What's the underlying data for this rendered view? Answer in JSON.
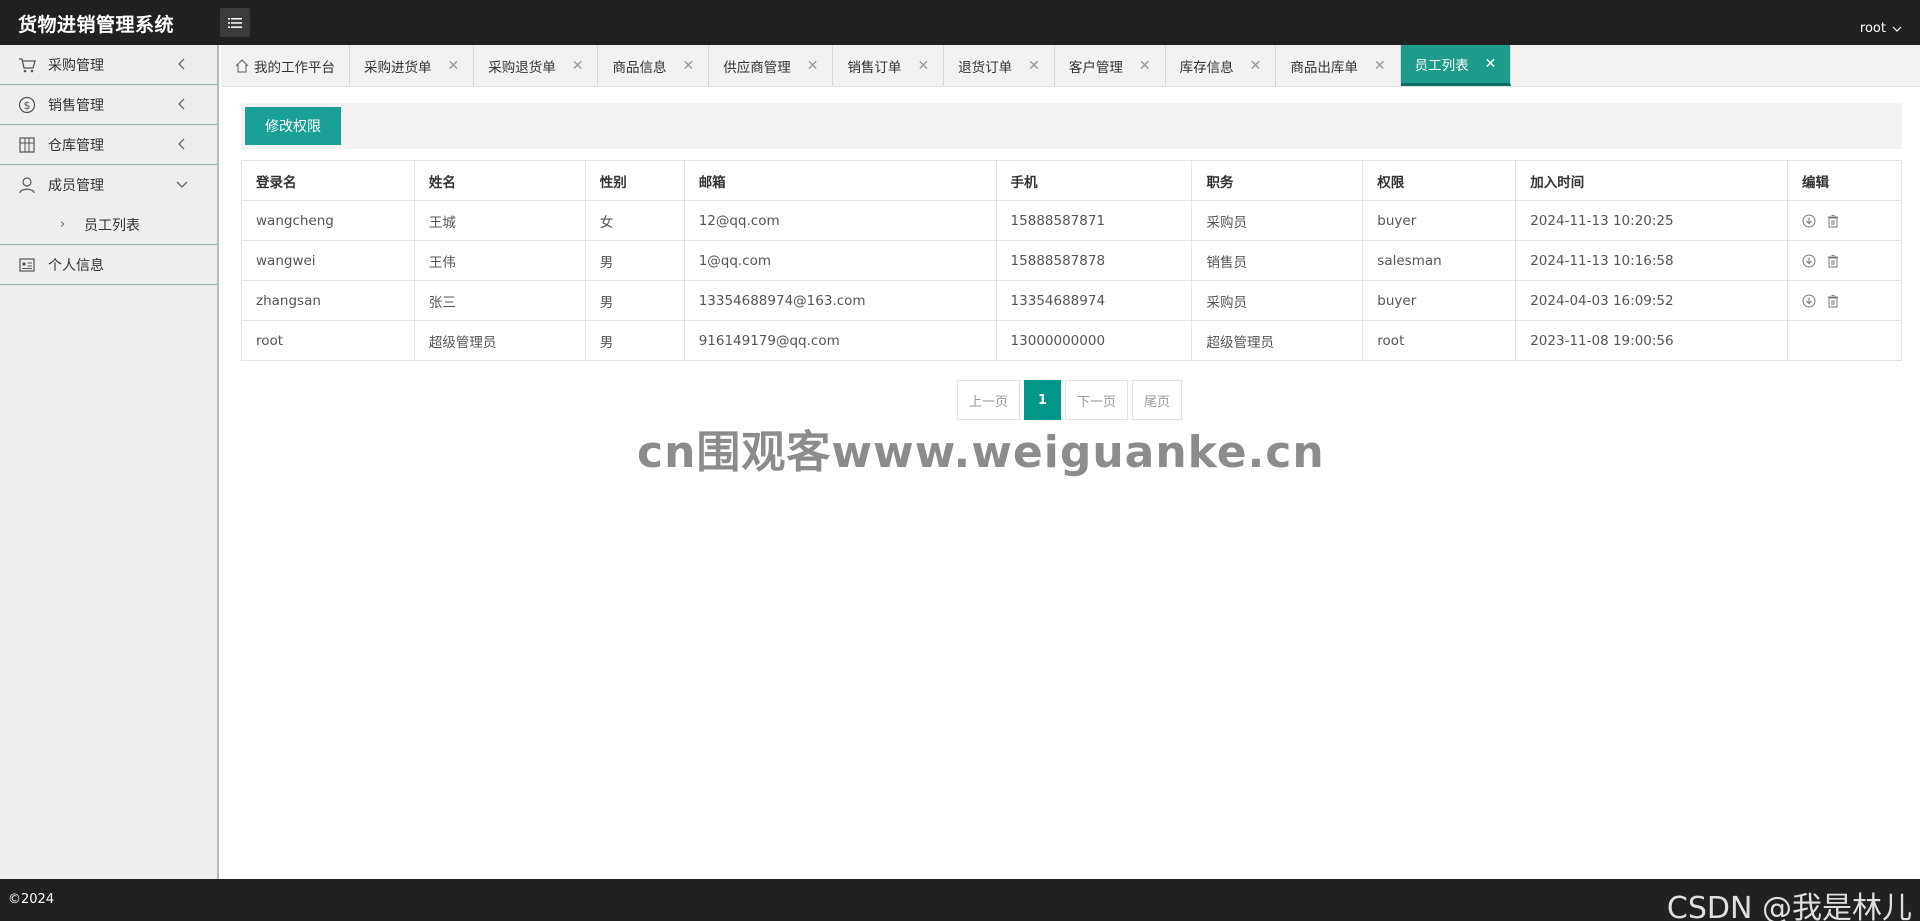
{
  "header": {
    "app_title": "货物进销管理系统",
    "user_name": "root"
  },
  "sidebar": {
    "items": [
      {
        "label": "采购管理",
        "icon": "cart-icon"
      },
      {
        "label": "销售管理",
        "icon": "dollar-icon"
      },
      {
        "label": "仓库管理",
        "icon": "warehouse-icon"
      },
      {
        "label": "成员管理",
        "icon": "user-icon"
      },
      {
        "label": "个人信息",
        "icon": "id-card-icon"
      }
    ],
    "sub_items": [
      {
        "label": "员工列表"
      }
    ]
  },
  "tabs": [
    {
      "label": "我的工作平台"
    },
    {
      "label": "采购进货单"
    },
    {
      "label": "采购退货单"
    },
    {
      "label": "商品信息"
    },
    {
      "label": "供应商管理"
    },
    {
      "label": "销售订单"
    },
    {
      "label": "退货订单"
    },
    {
      "label": "客户管理"
    },
    {
      "label": "库存信息"
    },
    {
      "label": "商品出库单"
    },
    {
      "label": "员工列表"
    }
  ],
  "toolbar": {
    "edit_perm_label": "修改权限"
  },
  "table": {
    "columns": [
      "登录名",
      "姓名",
      "性别",
      "邮箱",
      "手机",
      "职务",
      "权限",
      "加入时间",
      "编辑"
    ],
    "rows": [
      [
        "wangcheng",
        "王城",
        "女",
        "12@qq.com",
        "15888587871",
        "采购员",
        "buyer",
        "2024-11-13 10:20:25"
      ],
      [
        "wangwei",
        "王伟",
        "男",
        "1@qq.com",
        "15888587878",
        "销售员",
        "salesman",
        "2024-11-13 10:16:58"
      ],
      [
        "zhangsan",
        "张三",
        "男",
        "13354688974@163.com",
        "13354688974",
        "采购员",
        "buyer",
        "2024-04-03 16:09:52"
      ],
      [
        "root",
        "超级管理员",
        "男",
        "916149179@qq.com",
        "13000000000",
        "超级管理员",
        "root",
        "2023-11-08 19:00:56"
      ]
    ]
  },
  "pager": {
    "prev": "上一页",
    "current": "1",
    "next": "下一页",
    "last": "尾页"
  },
  "watermark": "cn围观客www.weiguanke.cn",
  "footer": {
    "copyright": "©2024",
    "csdn": "CSDN @我是林儿"
  },
  "colors": {
    "accent": "#009688",
    "active_tab": "#1e9b8a",
    "header_bg": "#212121"
  }
}
